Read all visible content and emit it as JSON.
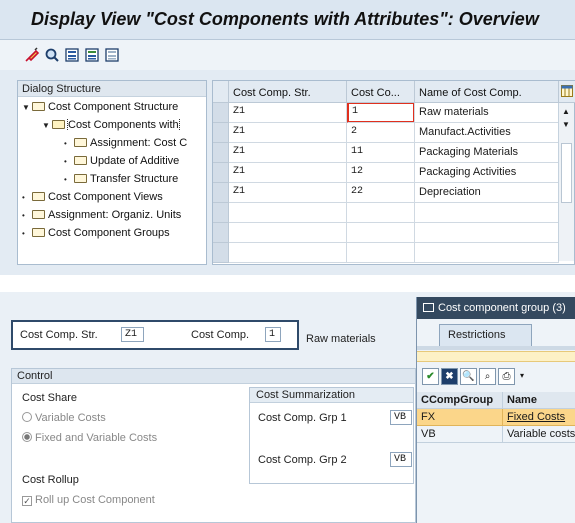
{
  "window": {
    "title": "Display View \"Cost Components with Attributes\": Overview"
  },
  "toolbar": {
    "icons": [
      "change-display-icon",
      "find-icon",
      "select-all-icon",
      "select-block-icon",
      "deselect-icon"
    ]
  },
  "dialog_structure": {
    "header": "Dialog Structure",
    "items": [
      {
        "label": "Cost Component Structure",
        "level": 0,
        "expanded": true
      },
      {
        "label": "Cost Components with",
        "level": 1,
        "expanded": true,
        "selected": true
      },
      {
        "label": "Assignment: Cost C",
        "level": 2
      },
      {
        "label": "Update of Additive",
        "level": 2
      },
      {
        "label": "Transfer Structure",
        "level": 2
      },
      {
        "label": "Cost Component Views",
        "level": 0
      },
      {
        "label": "Assignment: Organiz. Units",
        "level": 0
      },
      {
        "label": "Cost Component Groups",
        "level": 0
      }
    ]
  },
  "table": {
    "columns": [
      "Cost Comp. Str.",
      "Cost Co...",
      "Name of Cost Comp."
    ],
    "rows": [
      {
        "str": "Z1",
        "comp": "1",
        "name": "Raw materials"
      },
      {
        "str": "Z1",
        "comp": "2",
        "name": "Manufact.Activities"
      },
      {
        "str": "Z1",
        "comp": "11",
        "name": "Packaging Materials"
      },
      {
        "str": "Z1",
        "comp": "12",
        "name": "Packaging Activities"
      },
      {
        "str": "Z1",
        "comp": "22",
        "name": "Depreciation"
      }
    ]
  },
  "detail": {
    "str_label": "Cost Comp. Str.",
    "str_value": "Z1",
    "comp_label": "Cost Comp.",
    "comp_value": "1",
    "name_value": "Raw materials",
    "control_header": "Control",
    "cost_share_label": "Cost Share",
    "variable_costs": "Variable Costs",
    "fixed_variable_costs": "Fixed and Variable Costs",
    "cost_rollup_label": "Cost Rollup",
    "rollup_checkbox": "Roll up Cost Component",
    "summ_header": "Cost Summarization",
    "grp1_label": "Cost Comp. Grp 1",
    "grp1_value": "VB",
    "grp2_label": "Cost Comp. Grp 2",
    "grp2_value": "VB"
  },
  "popup": {
    "title": "Cost component group (3)",
    "tab": "Restrictions",
    "columns": [
      "CCompGroup",
      "Name"
    ],
    "rows": [
      {
        "group": "FX",
        "name": "Fixed Costs",
        "highlighted": true
      },
      {
        "group": "VB",
        "name": "Variable costs"
      }
    ]
  },
  "colors": {
    "accent": "#2f4a6a",
    "highlight": "#fbd68a",
    "error_marker": "#e0301e"
  }
}
